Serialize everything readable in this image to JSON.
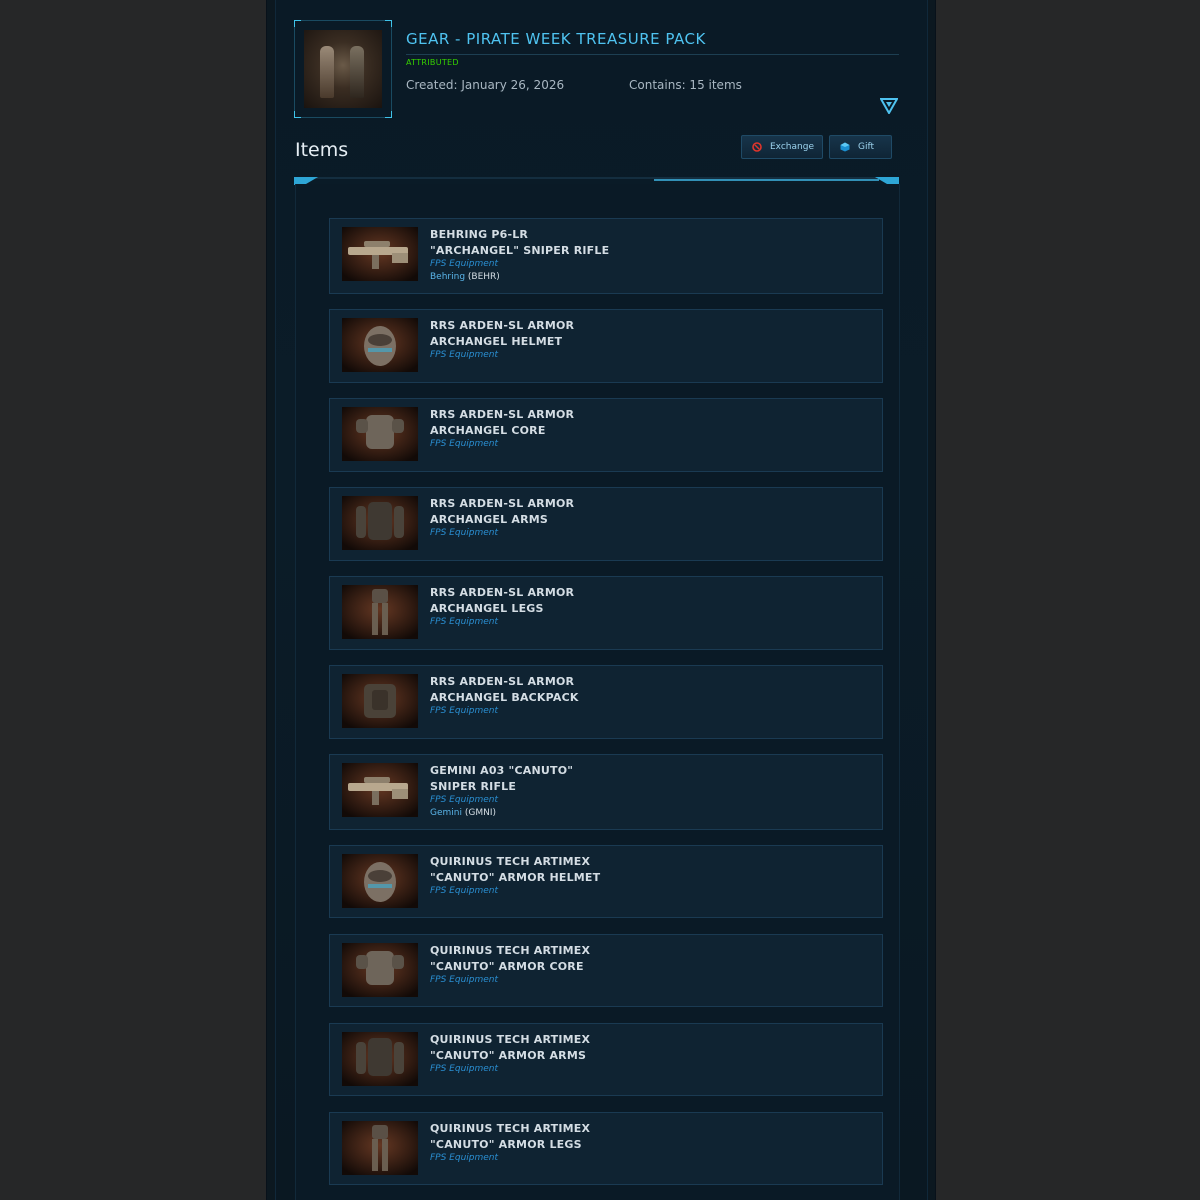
{
  "pack": {
    "title": "GEAR - PIRATE WEEK TREASURE PACK",
    "status": "ATTRIBUTED",
    "created": "Created: January 26, 2026",
    "contains": "Contains: 15 items"
  },
  "items_section": {
    "heading": "Items",
    "exchange_label": "Exchange",
    "gift_label": "Gift"
  },
  "colors": {
    "accent": "#4fc3f0",
    "status_green": "#36d000",
    "type_blue": "#2a8fd2"
  },
  "items": [
    {
      "name": "BEHRING P6-LR\n\"ARCHANGEL\" SNIPER RIFLE",
      "type": "FPS Equipment",
      "brand": "Behring",
      "code": "(BEHR)",
      "icon": "rifle"
    },
    {
      "name": "RRS ARDEN-SL ARMOR\nARCHANGEL HELMET",
      "type": "FPS Equipment",
      "icon": "helmet"
    },
    {
      "name": "RRS ARDEN-SL ARMOR\nARCHANGEL CORE",
      "type": "FPS Equipment",
      "icon": "core"
    },
    {
      "name": "RRS ARDEN-SL ARMOR\nARCHANGEL ARMS",
      "type": "FPS Equipment",
      "icon": "arms"
    },
    {
      "name": "RRS ARDEN-SL ARMOR\nARCHANGEL LEGS",
      "type": "FPS Equipment",
      "icon": "legs"
    },
    {
      "name": "RRS ARDEN-SL ARMOR\nARCHANGEL BACKPACK",
      "type": "FPS Equipment",
      "icon": "backpack"
    },
    {
      "name": "GEMINI A03 \"CANUTO\"\nSNIPER RIFLE",
      "type": "FPS Equipment",
      "brand": "Gemini",
      "code": "(GMNI)",
      "icon": "rifle"
    },
    {
      "name": "QUIRINUS TECH ARTIMEX\n\"CANUTO\" ARMOR HELMET",
      "type": "FPS Equipment",
      "icon": "helmet"
    },
    {
      "name": "QUIRINUS TECH ARTIMEX\n\"CANUTO\" ARMOR CORE",
      "type": "FPS Equipment",
      "icon": "core"
    },
    {
      "name": "QUIRINUS TECH ARTIMEX\n\"CANUTO\" ARMOR ARMS",
      "type": "FPS Equipment",
      "icon": "arms"
    },
    {
      "name": "QUIRINUS TECH ARTIMEX\n\"CANUTO\" ARMOR LEGS",
      "type": "FPS Equipment",
      "icon": "legs"
    }
  ]
}
